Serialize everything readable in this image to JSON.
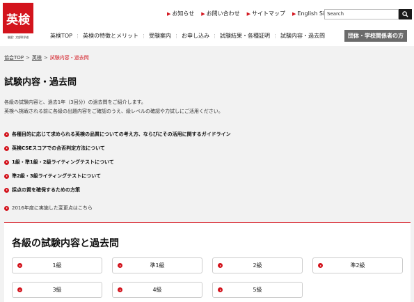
{
  "logo": {
    "text": "英検",
    "sub": "後援：文部科学省"
  },
  "utility_links": [
    {
      "label": "お知らせ"
    },
    {
      "label": "お問い合わせ"
    },
    {
      "label": "サイトマップ"
    },
    {
      "label": "English Site"
    }
  ],
  "search": {
    "value": "Search"
  },
  "gnav": [
    {
      "label": "英検TOP"
    },
    {
      "label": "英検の特徴とメリット"
    },
    {
      "label": "受験案内"
    },
    {
      "label": "お申し込み"
    },
    {
      "label": "試験結果・各種証明"
    },
    {
      "label": "試験内容・過去問"
    }
  ],
  "gnav_button": "団体・学校関係者の方",
  "breadcrumb": {
    "items": [
      "協会TOP",
      "英検"
    ],
    "current": "試験内容・過去問",
    "sep": ">"
  },
  "page_title": "試験内容・過去問",
  "intro": {
    "line1": "各級の試験内容と、過去1年（3回分）の過去問をご紹介します。",
    "line2": "英検へ挑戦される前に各級の出題内容をご確認のうえ、級レベルの確認や力試しにご活用ください。"
  },
  "links": [
    {
      "label": "各種目的に応じて求められる英検の品質についての考え方、ならびにその活用に関するガイドライン"
    },
    {
      "label": "英検CSEスコアでの合否判定方法について"
    },
    {
      "label": "1級・準1級・2級ライティングテストについて"
    },
    {
      "label": "準2級・3級ライティングテストについて"
    },
    {
      "label": "採点の質を確保するための方策"
    }
  ],
  "plain_link": "2016年度に実施した変更点はこちら",
  "section_title": "各級の試験内容と過去問",
  "grades": [
    {
      "label": "1級"
    },
    {
      "label": "準1級"
    },
    {
      "label": "2級"
    },
    {
      "label": "準2級"
    },
    {
      "label": "3級"
    },
    {
      "label": "4級"
    },
    {
      "label": "5級"
    }
  ],
  "colors": {
    "brand": "#d3141d",
    "nav_button": "#6b6b6b",
    "search_button": "#1a1a1a"
  },
  "icons": {
    "bullet": "circle-arrow-icon",
    "search": "magnifier-icon",
    "utility": "triangle-arrow-icon"
  }
}
